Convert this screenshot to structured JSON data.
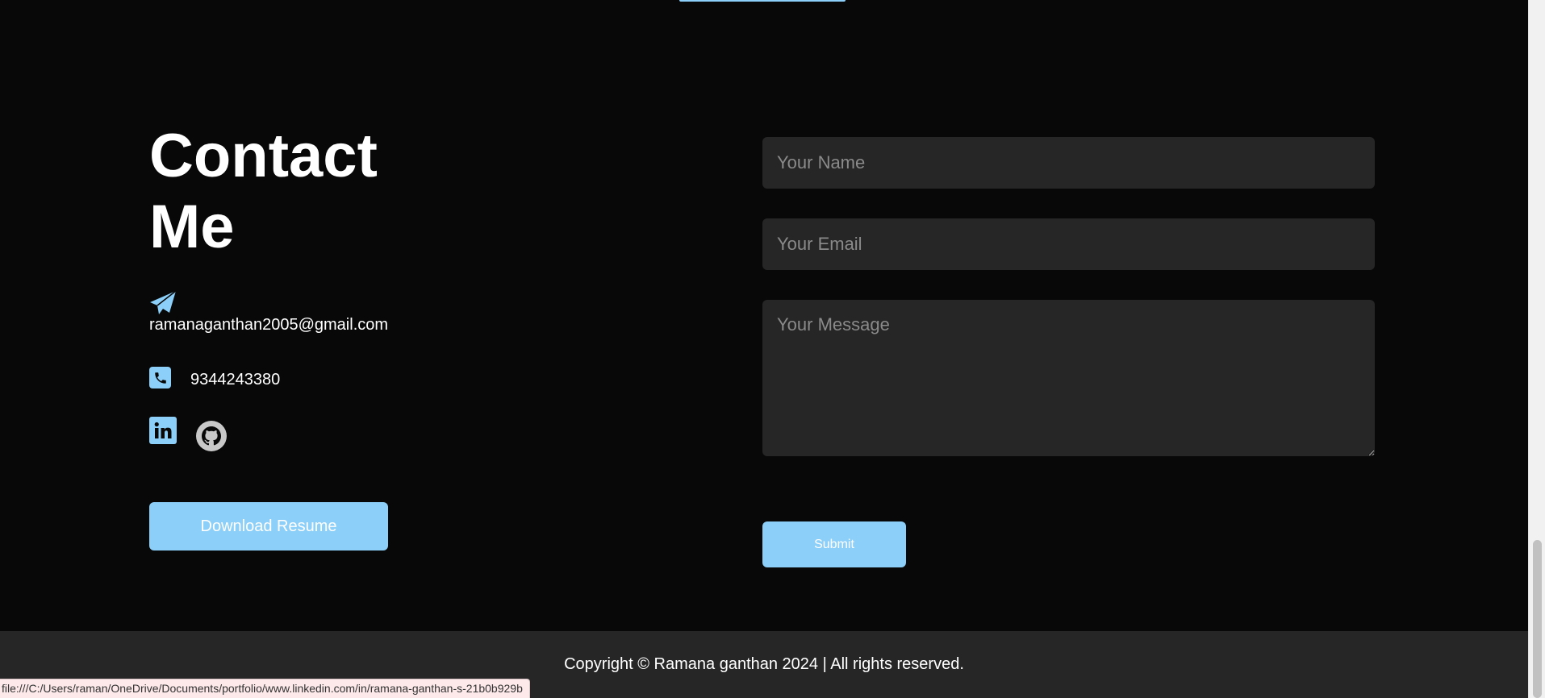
{
  "contact": {
    "title": "Contact Me",
    "email": "ramanaganthan2005@gmail.com",
    "phone": "9344243380",
    "resume_button": "Download Resume",
    "icons": [
      "paper-plane-icon",
      "phone-icon",
      "linkedin-icon",
      "github-icon"
    ]
  },
  "form": {
    "name_placeholder": "Your Name",
    "email_placeholder": "Your Email",
    "message_placeholder": "Your Message",
    "submit_label": "Submit"
  },
  "footer": {
    "copyright": "Copyright © Ramana ganthan 2024 | All rights reserved."
  },
  "status_bar": {
    "url": "file:///C:/Users/raman/OneDrive/Documents/portfolio/www.linkedin.com/in/ramana-ganthan-s-21b0b929b"
  },
  "colors": {
    "background": "#080808",
    "accent": "#8ccff8",
    "field_background": "#262626",
    "footer_background": "#262626",
    "placeholder": "#8a8a8a"
  }
}
